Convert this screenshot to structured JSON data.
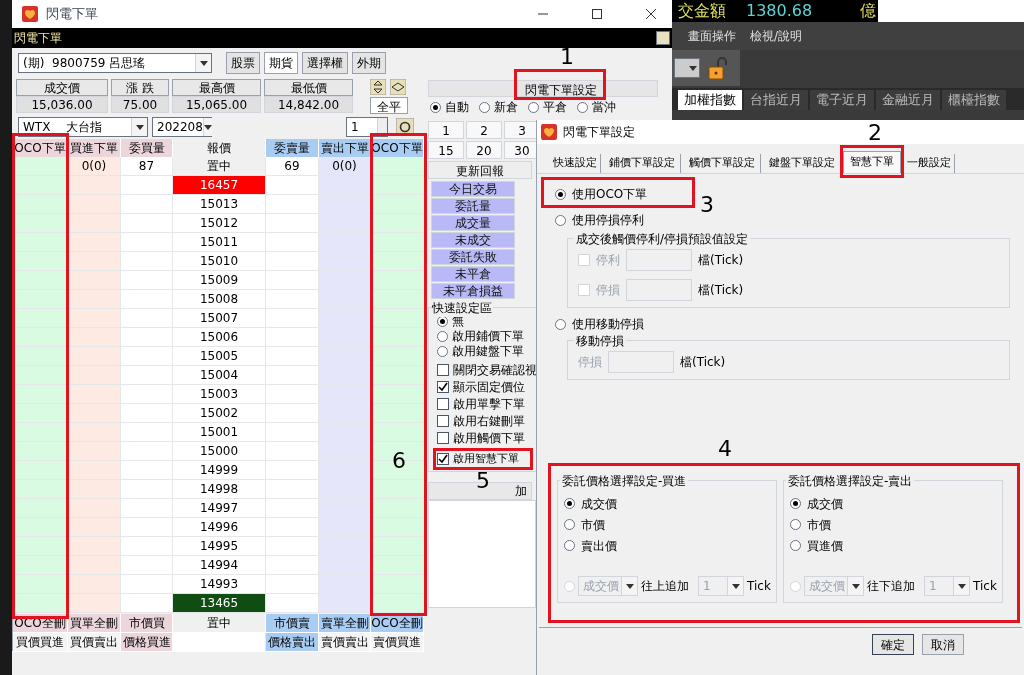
{
  "background_app": {
    "turnover_label": "交金額",
    "turnover_value": "1380.68",
    "turnover_unit": "億",
    "menu": [
      "畫面操作",
      "檢視/說明"
    ],
    "market_tabs": [
      {
        "label": "加權指數",
        "selected": true
      },
      {
        "label": "台指近月",
        "selected": false
      },
      {
        "label": "電子近月",
        "selected": false
      },
      {
        "label": "金融近月",
        "selected": false
      },
      {
        "label": "櫃檯指數",
        "selected": false
      }
    ]
  },
  "main_window": {
    "title": "閃電下單",
    "header": "閃電下單",
    "account": "(期)  9800759 呂思瑤",
    "market_buttons": [
      {
        "label": "股票",
        "selected": false
      },
      {
        "label": "期貨",
        "selected": true
      },
      {
        "label": "選擇權",
        "selected": false
      },
      {
        "label": "外期",
        "selected": false
      }
    ],
    "quote_fields": [
      {
        "label": "成交價",
        "value": "15,036.00"
      },
      {
        "label": "漲 跌",
        "value": "75.00"
      },
      {
        "label": "最高價",
        "value": "15,065.00"
      },
      {
        "label": "最低價",
        "value": "14,842.00"
      }
    ],
    "close_all": "全平",
    "symbol": "WTX    大台指",
    "month": "202208",
    "quantity": "1",
    "settings_button": "閃電下單設定",
    "position_modes": [
      {
        "label": "自動",
        "selected": true
      },
      {
        "label": "新倉",
        "selected": false
      },
      {
        "label": "平倉",
        "selected": false
      },
      {
        "label": "當沖",
        "selected": false
      }
    ],
    "quantity_buttons": [
      "1",
      "2",
      "3",
      "15",
      "20",
      "30"
    ],
    "ladder": {
      "columns": [
        "OCO下單",
        "買進下單",
        "委買量",
        "報價",
        "委賣量",
        "賣出下單",
        "OCO下單"
      ],
      "rows": [
        {
          "kind": "center",
          "buy_orders": "0(0)",
          "bid_qty": "87",
          "price": "置中",
          "ask_qty": "69",
          "sell_orders": "0(0)"
        },
        {
          "kind": "limit_up",
          "price": "16457"
        },
        {
          "kind": "price",
          "price": "15013"
        },
        {
          "kind": "price",
          "price": "15012"
        },
        {
          "kind": "price",
          "price": "15011"
        },
        {
          "kind": "price",
          "price": "15010"
        },
        {
          "kind": "price",
          "price": "15009"
        },
        {
          "kind": "price",
          "price": "15008"
        },
        {
          "kind": "price",
          "price": "15007"
        },
        {
          "kind": "price",
          "price": "15006"
        },
        {
          "kind": "price",
          "price": "15005"
        },
        {
          "kind": "price",
          "price": "15004"
        },
        {
          "kind": "price",
          "price": "15003"
        },
        {
          "kind": "price",
          "price": "15002"
        },
        {
          "kind": "price",
          "price": "15001"
        },
        {
          "kind": "price",
          "price": "15000"
        },
        {
          "kind": "price",
          "price": "14999"
        },
        {
          "kind": "price",
          "price": "14998"
        },
        {
          "kind": "price",
          "price": "14997"
        },
        {
          "kind": "price",
          "price": "14996"
        },
        {
          "kind": "price",
          "price": "14995"
        },
        {
          "kind": "price",
          "price": "14994"
        },
        {
          "kind": "price",
          "price": "14993"
        },
        {
          "kind": "limit_down",
          "price": "13465"
        }
      ],
      "footer_rows": [
        [
          "OCO全刪",
          "買單全刪",
          "市價買",
          "置中",
          "市價賣",
          "賣單全刪",
          "OCO全刪"
        ],
        [
          "買價買進",
          "買價賣出",
          "價格買進",
          null,
          "價格賣出",
          "賣價賣出",
          "賣價買進"
        ]
      ]
    },
    "refresh_button": "更新回報",
    "report_buttons": [
      "今日交易",
      "委託量",
      "成交量",
      "未成交",
      "委託失敗",
      "未平倉",
      "未平倉損益"
    ],
    "quick_settings": {
      "title": "快速設定區",
      "modes": [
        {
          "label": "無",
          "selected": true
        },
        {
          "label": "啟用鋪價下單",
          "selected": false
        },
        {
          "label": "啟用鍵盤下單",
          "selected": false
        }
      ],
      "options": [
        {
          "label": "關閉交易確認視",
          "checked": false
        },
        {
          "label": "顯示固定價位",
          "checked": true
        },
        {
          "label": "啟用單擊下單",
          "checked": false
        },
        {
          "label": "啟用右鍵刪單",
          "checked": false
        },
        {
          "label": "啟用觸價下單",
          "checked": false
        },
        {
          "label": "啟用智慧下單",
          "checked": true
        }
      ]
    },
    "bottom_label": "加"
  },
  "dialog": {
    "title": "閃電下單設定",
    "tabs": [
      {
        "label": "快速設定",
        "selected": false
      },
      {
        "label": "鋪價下單設定",
        "selected": false
      },
      {
        "label": "觸價下單設定",
        "selected": false
      },
      {
        "label": "鍵盤下單設定",
        "selected": false
      },
      {
        "label": "智慧下單",
        "selected": true
      },
      {
        "label": "一般設定",
        "selected": false
      }
    ],
    "oco": {
      "label": "使用OCO下單",
      "selected": true
    },
    "stop_profit": {
      "label": "使用停損停利",
      "selected": false,
      "group": "成交後觸價停利/停損預設值設定",
      "rows": [
        {
          "label": "停利",
          "checked": false,
          "unit": "檔(Tick)"
        },
        {
          "label": "停損",
          "checked": false,
          "unit": "檔(Tick)"
        }
      ]
    },
    "trailing": {
      "label": "使用移動停損",
      "selected": false,
      "group": "移動停損",
      "row_label": "停損",
      "unit": "檔(Tick)"
    },
    "price_groups": [
      {
        "title": "委託價格選擇設定-買進",
        "options": [
          {
            "label": "成交價",
            "selected": true
          },
          {
            "label": "市價",
            "selected": false
          },
          {
            "label": "賣出價",
            "selected": false
          }
        ],
        "custom": {
          "selected": false,
          "base": "成交價",
          "direction": "往上追加",
          "ticks": "1",
          "unit": "Tick"
        }
      },
      {
        "title": "委託價格選擇設定-賣出",
        "options": [
          {
            "label": "成交價",
            "selected": true
          },
          {
            "label": "市價",
            "selected": false
          },
          {
            "label": "買進價",
            "selected": false
          }
        ],
        "custom": {
          "selected": false,
          "base": "成交價",
          "direction": "往下追加",
          "ticks": "1",
          "unit": "Tick"
        }
      }
    ],
    "buttons": [
      "確定",
      "取消"
    ]
  },
  "annotations": [
    {
      "label": "1"
    },
    {
      "label": "2"
    },
    {
      "label": "3"
    },
    {
      "label": "4"
    },
    {
      "label": "5"
    },
    {
      "label": "6"
    }
  ]
}
